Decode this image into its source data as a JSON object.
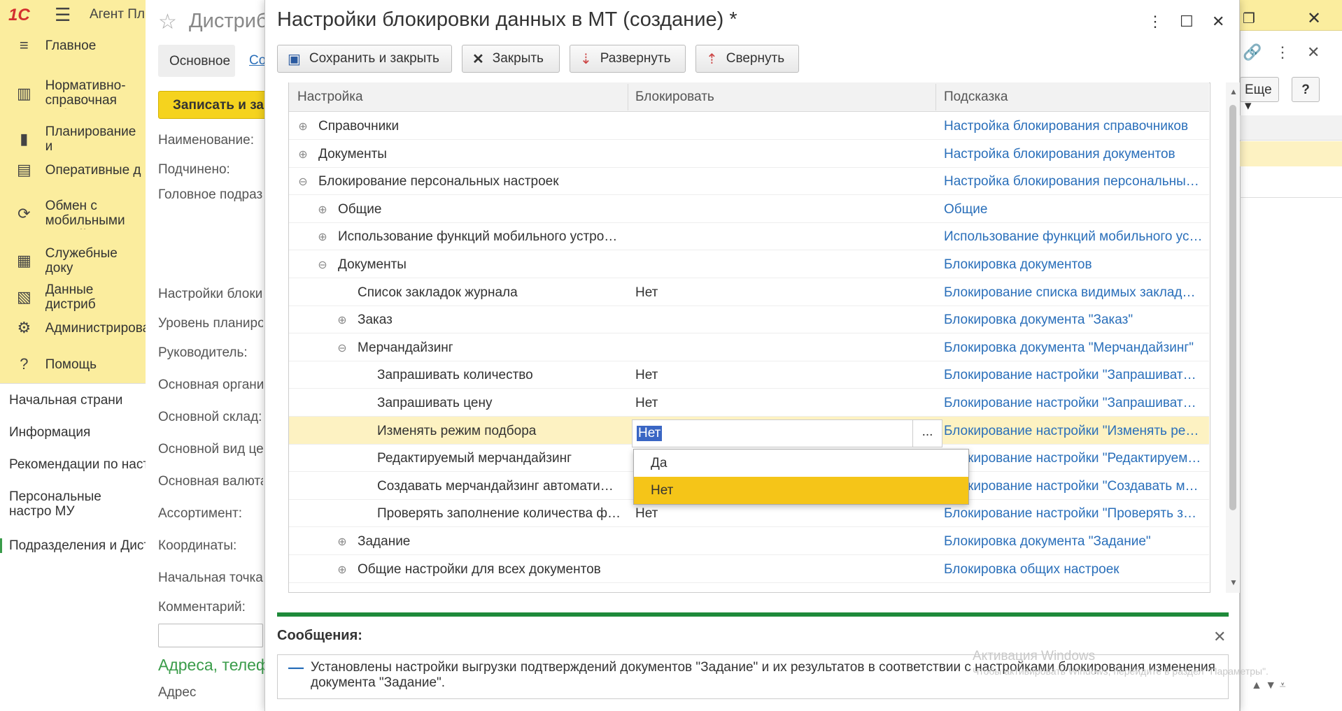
{
  "app": {
    "title": "Агент Плюс",
    "logo": "1С"
  },
  "nav": {
    "items": [
      {
        "icon": "≡",
        "label": "Главное"
      },
      {
        "icon": "▥",
        "label": "Нормативно-справочная информация"
      },
      {
        "icon": "▮",
        "label": "Планирование и"
      },
      {
        "icon": "▤",
        "label": "Оперативные д"
      },
      {
        "icon": "⟳",
        "label": "Обмен с мобильными устройствами"
      },
      {
        "icon": "▦",
        "label": "Служебные доку"
      },
      {
        "icon": "▧",
        "label": "Данные дистриб"
      },
      {
        "icon": "⚙",
        "label": "Администрирова"
      },
      {
        "icon": "?",
        "label": "Помощь"
      }
    ],
    "open": [
      "Начальная страни",
      "Информация",
      "Рекомендации по наст",
      "Персональные настро МУ",
      "Подразделения и Дист"
    ]
  },
  "backform": {
    "title": "Дистриб",
    "tab_main": "Основное",
    "tab_other": "Со",
    "save_label": "Записать и зак",
    "labels": [
      "Наименование:",
      "Подчинено:",
      "Головное подраз",
      "Настройки блокир",
      "Уровень планиро",
      "Руководитель:",
      "Основная органи",
      "Основной склад:",
      "Основной вид це",
      "Основная валюта",
      "Ассортимент:",
      "Координаты:",
      "Начальная точка",
      "Комментарий:"
    ],
    "address_heading": "Адреса, телеф",
    "address_label": "Адрес"
  },
  "modal": {
    "title": "Настройки блокировки данных в МТ (создание) *",
    "buttons": {
      "save_close": "Сохранить и закрыть",
      "close": "Закрыть",
      "expand": "Развернуть",
      "collapse": "Свернуть"
    },
    "columns": {
      "setting": "Настройка",
      "block": "Блокировать",
      "hint": "Подсказка"
    },
    "rows": [
      {
        "toggle": "⊕",
        "level": 0,
        "label": "Справочники",
        "value": "",
        "hint": "Настройка блокирования справочников"
      },
      {
        "toggle": "⊕",
        "level": 0,
        "label": "Документы",
        "value": "",
        "hint": "Настройка блокирования документов"
      },
      {
        "toggle": "⊖",
        "level": 0,
        "label": "Блокирование персональных настроек",
        "value": "",
        "hint": "Настройка блокирования персональных…"
      },
      {
        "toggle": "⊕",
        "level": 1,
        "label": "Общие",
        "value": "",
        "hint": "Общие"
      },
      {
        "toggle": "⊕",
        "level": 1,
        "label": "Использование функций мобильного устро…",
        "value": "",
        "hint": "Использование функций мобильного ус…"
      },
      {
        "toggle": "⊖",
        "level": 1,
        "label": "Документы",
        "value": "",
        "hint": "Блокировка документов"
      },
      {
        "toggle": "",
        "level": 2,
        "label": "Список закладок журнала",
        "value": "Нет",
        "hint": "Блокирование списка видимых закладо…"
      },
      {
        "toggle": "⊕",
        "level": 2,
        "label": "Заказ",
        "value": "",
        "hint": "Блокировка документа \"Заказ\""
      },
      {
        "toggle": "⊖",
        "level": 2,
        "label": "Мерчандайзинг",
        "value": "",
        "hint": "Блокировка документа \"Мерчандайзинг\""
      },
      {
        "toggle": "",
        "level": 3,
        "label": "Запрашивать количество",
        "value": "Нет",
        "hint": "Блокирование настройки \"Запрашивать…"
      },
      {
        "toggle": "",
        "level": 3,
        "label": "Запрашивать цену",
        "value": "Нет",
        "hint": "Блокирование настройки \"Запрашивать…"
      },
      {
        "toggle": "",
        "level": 3,
        "label": "Изменять режим подбора",
        "value": "",
        "hint": "Блокирование настройки \"Изменять ре…",
        "selected": true
      },
      {
        "toggle": "",
        "level": 3,
        "label": "Редактируемый мерчандайзинг",
        "value": "",
        "hint": "Блокирование настройки \"Редактируем…"
      },
      {
        "toggle": "",
        "level": 3,
        "label": "Создавать мерчандайзинг автомати…",
        "value": "",
        "hint": "Блокирование настройки \"Создавать м…"
      },
      {
        "toggle": "",
        "level": 3,
        "label": "Проверять заполнение количества ф…",
        "value": "Нет",
        "hint": "Блокирование настройки \"Проверять з…"
      },
      {
        "toggle": "⊕",
        "level": 2,
        "label": "Задание",
        "value": "",
        "hint": "Блокировка документа \"Задание\""
      },
      {
        "toggle": "⊕",
        "level": 2,
        "label": "Общие настройки для всех документов",
        "value": "",
        "hint": "Блокировка общих настроек"
      }
    ],
    "edit_value": "Нет",
    "edit_button": "...",
    "dropdown": [
      "Да",
      "Нет"
    ]
  },
  "messages": {
    "title": "Сообщения:",
    "text": "Установлены настройки выгрузки подтверждений документов \"Задание\" и их результатов в соответствии с настройками блокирования изменения документа \"Задание\"."
  },
  "right": {
    "more": "Еще",
    "help": "?"
  },
  "watermark": {
    "line1": "Активация Windows",
    "line2": "Чтобы активировать Windows, перейдите в раздел \"Параметры\"."
  },
  "colors": {
    "panel": "#fbed9e",
    "accent": "#f5c518",
    "link": "#2a6fba",
    "green": "#1e8a3a"
  }
}
